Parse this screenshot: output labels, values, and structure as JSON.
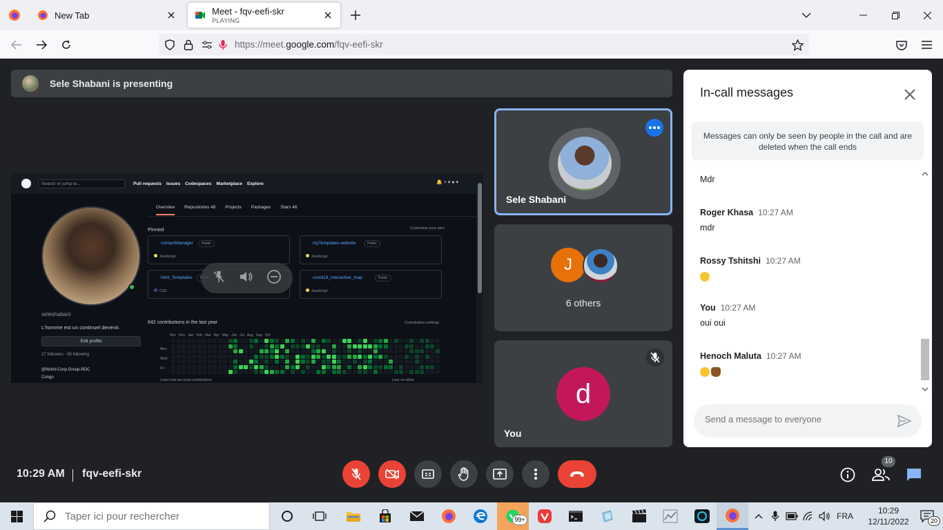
{
  "browser": {
    "tabs": [
      {
        "title": "New Tab",
        "subtitle": "",
        "active": false
      },
      {
        "title": "Meet - fqv-eefi-skr",
        "subtitle": "PLAYING",
        "active": true
      }
    ],
    "url_prefix": "https://meet.",
    "url_host": "google.com",
    "url_path": "/fqv-eefi-skr"
  },
  "meet": {
    "presenting_text": "Sele Shabani is presenting",
    "screen_share": {
      "search_placeholder": "Search or jump to...",
      "nav": [
        "Pull requests",
        "Issues",
        "Codespaces",
        "Marketplace",
        "Explore"
      ],
      "tabs": [
        "Overview",
        "Repositories 48",
        "Projects",
        "Packages",
        "Stars 46"
      ],
      "pinned_label": "Pinned",
      "customize_label": "Customize your pins",
      "username": "seleshabani",
      "bio": "L'homme est un continuel devenir.",
      "edit_profile": "Edit profile",
      "followers": "27 followers · 65 following",
      "org": "@World-Corp-Group-RDC",
      "location": "Congo",
      "repos": [
        {
          "name": "contactManager",
          "lang": "JavaScript",
          "badge": "Public"
        },
        {
          "name": "myTemplates-website",
          "lang": "JavaScript",
          "badge": "Public"
        },
        {
          "name": "html_Templates",
          "lang": "CSS",
          "badge": "Public"
        },
        {
          "name": "covid19_interactive_map",
          "lang": "JavaScript",
          "badge": "Public"
        }
      ],
      "contributions": "642 contributions in the last year",
      "contrib_settings": "Contribution settings",
      "months": "Nov   Dec   Jan   Feb   Mar   Apr   May   Jun   Jul   Aug   Sep   Oct",
      "days": [
        "Mon",
        "Wed",
        "Fri"
      ],
      "learn": "Learn how we count contributions",
      "less_more": "Less ▪▪▪▪ More"
    },
    "tiles": {
      "presenter_name": "Sele Shabani",
      "group_initial": "J",
      "others_label": "6 others",
      "self_initial": "d",
      "self_label": "You"
    },
    "chat": {
      "title": "In-call messages",
      "notice": "Messages can only be seen by people in the call and are deleted when the call ends",
      "messages": [
        {
          "sender": "",
          "time": "",
          "text": "Mdr"
        },
        {
          "sender": "Roger Khasa",
          "time": "10:27 AM",
          "text": "mdr"
        },
        {
          "sender": "Rossy Tshitshi",
          "time": "10:27 AM",
          "text": ""
        },
        {
          "sender": "You",
          "time": "10:27 AM",
          "text": "oui oui"
        },
        {
          "sender": "Henoch Maluta",
          "time": "10:27 AM",
          "text": ""
        }
      ],
      "input_placeholder": "Send a message to everyone"
    },
    "bottom": {
      "time": "10:29 AM",
      "meeting_code": "fqv-eefi-skr",
      "participants_count": "10"
    }
  },
  "taskbar": {
    "search_placeholder": "Taper ici pour rechercher",
    "whatsapp_badge": "99+",
    "language": "FRA",
    "time": "10:29",
    "date": "12/11/2022",
    "notifications": "20"
  },
  "colors": {
    "meet_bg": "#202124",
    "tile_bg": "#3c4043",
    "accent_blue": "#1a73e8",
    "end_call_red": "#ea4335",
    "avatar_orange": "#e8710a",
    "avatar_magenta": "#c2185b"
  }
}
